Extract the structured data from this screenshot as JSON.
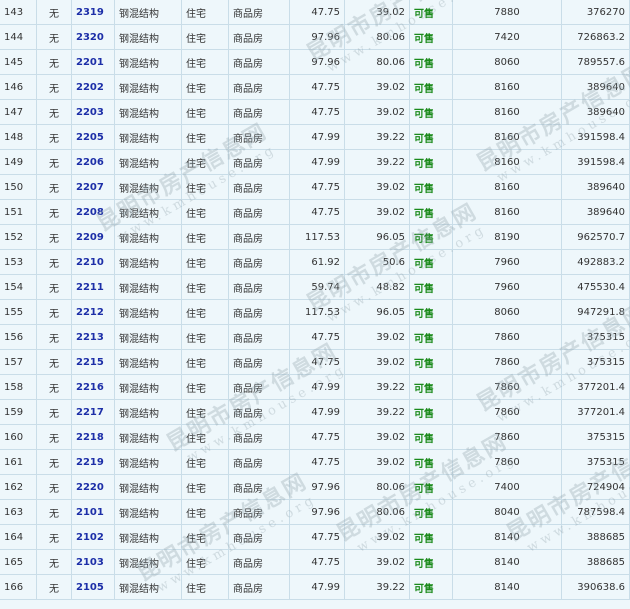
{
  "watermark": {
    "cn": "昆明市房产信息网",
    "en": "www.kmhouse.org"
  },
  "rows": [
    {
      "idx": "143",
      "mark": "无",
      "room": "2319",
      "structure": "钢混结构",
      "use": "住宅",
      "type": "商品房",
      "area": "47.75",
      "inner": "39.02",
      "status": "可售",
      "price": "7880",
      "total": "376270"
    },
    {
      "idx": "144",
      "mark": "无",
      "room": "2320",
      "structure": "钢混结构",
      "use": "住宅",
      "type": "商品房",
      "area": "97.96",
      "inner": "80.06",
      "status": "可售",
      "price": "7420",
      "total": "726863.2"
    },
    {
      "idx": "145",
      "mark": "无",
      "room": "2201",
      "structure": "钢混结构",
      "use": "住宅",
      "type": "商品房",
      "area": "97.96",
      "inner": "80.06",
      "status": "可售",
      "price": "8060",
      "total": "789557.6"
    },
    {
      "idx": "146",
      "mark": "无",
      "room": "2202",
      "structure": "钢混结构",
      "use": "住宅",
      "type": "商品房",
      "area": "47.75",
      "inner": "39.02",
      "status": "可售",
      "price": "8160",
      "total": "389640"
    },
    {
      "idx": "147",
      "mark": "无",
      "room": "2203",
      "structure": "钢混结构",
      "use": "住宅",
      "type": "商品房",
      "area": "47.75",
      "inner": "39.02",
      "status": "可售",
      "price": "8160",
      "total": "389640"
    },
    {
      "idx": "148",
      "mark": "无",
      "room": "2205",
      "structure": "钢混结构",
      "use": "住宅",
      "type": "商品房",
      "area": "47.99",
      "inner": "39.22",
      "status": "可售",
      "price": "8160",
      "total": "391598.4"
    },
    {
      "idx": "149",
      "mark": "无",
      "room": "2206",
      "structure": "钢混结构",
      "use": "住宅",
      "type": "商品房",
      "area": "47.99",
      "inner": "39.22",
      "status": "可售",
      "price": "8160",
      "total": "391598.4"
    },
    {
      "idx": "150",
      "mark": "无",
      "room": "2207",
      "structure": "钢混结构",
      "use": "住宅",
      "type": "商品房",
      "area": "47.75",
      "inner": "39.02",
      "status": "可售",
      "price": "8160",
      "total": "389640"
    },
    {
      "idx": "151",
      "mark": "无",
      "room": "2208",
      "structure": "钢混结构",
      "use": "住宅",
      "type": "商品房",
      "area": "47.75",
      "inner": "39.02",
      "status": "可售",
      "price": "8160",
      "total": "389640"
    },
    {
      "idx": "152",
      "mark": "无",
      "room": "2209",
      "structure": "钢混结构",
      "use": "住宅",
      "type": "商品房",
      "area": "117.53",
      "inner": "96.05",
      "status": "可售",
      "price": "8190",
      "total": "962570.7"
    },
    {
      "idx": "153",
      "mark": "无",
      "room": "2210",
      "structure": "钢混结构",
      "use": "住宅",
      "type": "商品房",
      "area": "61.92",
      "inner": "50.6",
      "status": "可售",
      "price": "7960",
      "total": "492883.2"
    },
    {
      "idx": "154",
      "mark": "无",
      "room": "2211",
      "structure": "钢混结构",
      "use": "住宅",
      "type": "商品房",
      "area": "59.74",
      "inner": "48.82",
      "status": "可售",
      "price": "7960",
      "total": "475530.4"
    },
    {
      "idx": "155",
      "mark": "无",
      "room": "2212",
      "structure": "钢混结构",
      "use": "住宅",
      "type": "商品房",
      "area": "117.53",
      "inner": "96.05",
      "status": "可售",
      "price": "8060",
      "total": "947291.8"
    },
    {
      "idx": "156",
      "mark": "无",
      "room": "2213",
      "structure": "钢混结构",
      "use": "住宅",
      "type": "商品房",
      "area": "47.75",
      "inner": "39.02",
      "status": "可售",
      "price": "7860",
      "total": "375315"
    },
    {
      "idx": "157",
      "mark": "无",
      "room": "2215",
      "structure": "钢混结构",
      "use": "住宅",
      "type": "商品房",
      "area": "47.75",
      "inner": "39.02",
      "status": "可售",
      "price": "7860",
      "total": "375315"
    },
    {
      "idx": "158",
      "mark": "无",
      "room": "2216",
      "structure": "钢混结构",
      "use": "住宅",
      "type": "商品房",
      "area": "47.99",
      "inner": "39.22",
      "status": "可售",
      "price": "7860",
      "total": "377201.4"
    },
    {
      "idx": "159",
      "mark": "无",
      "room": "2217",
      "structure": "钢混结构",
      "use": "住宅",
      "type": "商品房",
      "area": "47.99",
      "inner": "39.22",
      "status": "可售",
      "price": "7860",
      "total": "377201.4"
    },
    {
      "idx": "160",
      "mark": "无",
      "room": "2218",
      "structure": "钢混结构",
      "use": "住宅",
      "type": "商品房",
      "area": "47.75",
      "inner": "39.02",
      "status": "可售",
      "price": "7860",
      "total": "375315"
    },
    {
      "idx": "161",
      "mark": "无",
      "room": "2219",
      "structure": "钢混结构",
      "use": "住宅",
      "type": "商品房",
      "area": "47.75",
      "inner": "39.02",
      "status": "可售",
      "price": "7860",
      "total": "375315"
    },
    {
      "idx": "162",
      "mark": "无",
      "room": "2220",
      "structure": "钢混结构",
      "use": "住宅",
      "type": "商品房",
      "area": "97.96",
      "inner": "80.06",
      "status": "可售",
      "price": "7400",
      "total": "724904"
    },
    {
      "idx": "163",
      "mark": "无",
      "room": "2101",
      "structure": "钢混结构",
      "use": "住宅",
      "type": "商品房",
      "area": "97.96",
      "inner": "80.06",
      "status": "可售",
      "price": "8040",
      "total": "787598.4"
    },
    {
      "idx": "164",
      "mark": "无",
      "room": "2102",
      "structure": "钢混结构",
      "use": "住宅",
      "type": "商品房",
      "area": "47.75",
      "inner": "39.02",
      "status": "可售",
      "price": "8140",
      "total": "388685"
    },
    {
      "idx": "165",
      "mark": "无",
      "room": "2103",
      "structure": "钢混结构",
      "use": "住宅",
      "type": "商品房",
      "area": "47.75",
      "inner": "39.02",
      "status": "可售",
      "price": "8140",
      "total": "388685"
    },
    {
      "idx": "166",
      "mark": "无",
      "room": "2105",
      "structure": "钢混结构",
      "use": "住宅",
      "type": "商品房",
      "area": "47.99",
      "inner": "39.22",
      "status": "可售",
      "price": "8140",
      "total": "390638.6"
    }
  ]
}
